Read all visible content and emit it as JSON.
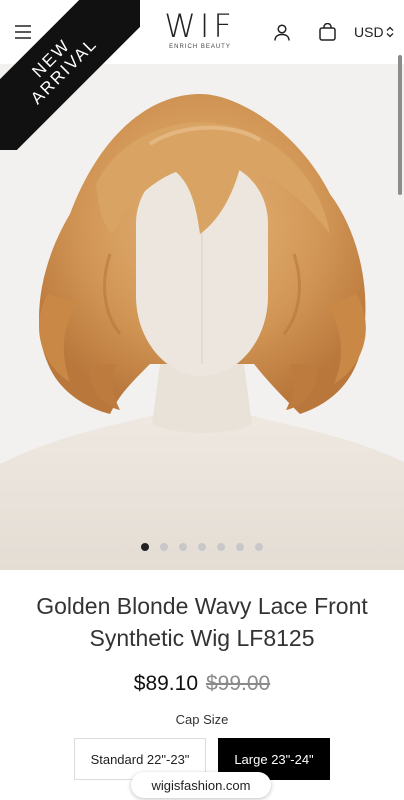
{
  "header": {
    "logo_text": "WIF",
    "logo_subtext": "ENRICH BEAUTY",
    "currency": "USD",
    "icons": [
      "menu-icon",
      "search-icon",
      "user-icon",
      "shopping-bag-icon",
      "chevron-updown-icon"
    ]
  },
  "ribbon": {
    "line1": "NEW",
    "line2": "ARRIVAL"
  },
  "gallery": {
    "slide_count": 7,
    "active_index": 0
  },
  "product": {
    "title": "Golden Blonde Wavy Lace Front Synthetic Wig LF8125",
    "price": "$89.10",
    "compare_price": "$99.00",
    "cap_size_label": "Cap Size",
    "cap_options": [
      {
        "label": "Standard 22\"-23\"",
        "selected": false
      },
      {
        "label": "Large 23\"-24\"",
        "selected": true
      }
    ]
  },
  "browser": {
    "url": "wigisfashion.com"
  },
  "colors": {
    "hair": "#d49a5c",
    "mannequin": "#ece6df",
    "selected_option": "#000000",
    "background": "#ffffff"
  }
}
